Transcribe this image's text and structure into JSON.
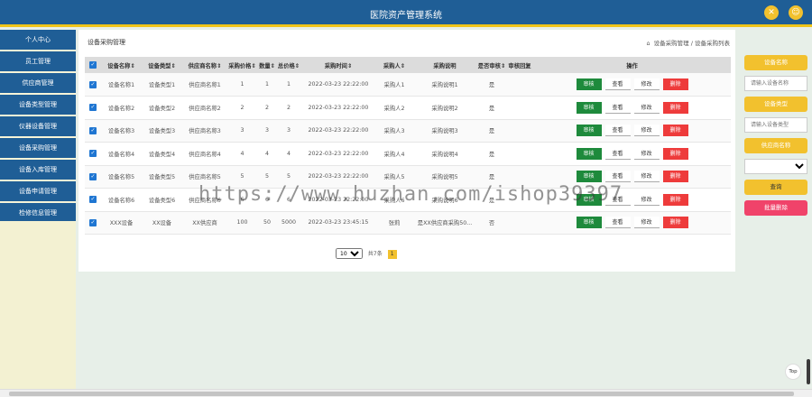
{
  "header": {
    "title": "医院资产管理系统"
  },
  "sidebar": {
    "items": [
      {
        "label": "个人中心"
      },
      {
        "label": "员工管理"
      },
      {
        "label": "供应商管理"
      },
      {
        "label": "设备类型管理"
      },
      {
        "label": "仪器设备管理"
      },
      {
        "label": "设备采购管理"
      },
      {
        "label": "设备入库管理"
      },
      {
        "label": "设备申请管理"
      },
      {
        "label": "检修信息管理"
      }
    ]
  },
  "page": {
    "title": "设备采购管理",
    "breadcrumb": "设备采购管理 / 设备采购列表"
  },
  "table": {
    "headers": [
      "设备名称⇕",
      "设备类型⇕",
      "供应商名称⇕",
      "采购价格⇕",
      "数量⇕",
      "总价格⇕",
      "采购时间⇕",
      "采购人⇕",
      "采购说明",
      "是否审核⇕",
      "审核回复",
      "操作"
    ],
    "rows": [
      [
        "设备名称1",
        "设备类型1",
        "供应商名称1",
        "1",
        "1",
        "1",
        "2022-03-23 22:22:00",
        "采购人1",
        "采购说明1",
        "是",
        ""
      ],
      [
        "设备名称2",
        "设备类型2",
        "供应商名称2",
        "2",
        "2",
        "2",
        "2022-03-23 22:22:00",
        "采购人2",
        "采购说明2",
        "是",
        ""
      ],
      [
        "设备名称3",
        "设备类型3",
        "供应商名称3",
        "3",
        "3",
        "3",
        "2022-03-23 22:22:00",
        "采购人3",
        "采购说明3",
        "是",
        ""
      ],
      [
        "设备名称4",
        "设备类型4",
        "供应商名称4",
        "4",
        "4",
        "4",
        "2022-03-23 22:22:00",
        "采购人4",
        "采购说明4",
        "是",
        ""
      ],
      [
        "设备名称5",
        "设备类型5",
        "供应商名称5",
        "5",
        "5",
        "5",
        "2022-03-23 22:22:00",
        "采购人5",
        "采购说明5",
        "是",
        ""
      ],
      [
        "设备名称6",
        "设备类型6",
        "供应商名称6",
        "6",
        "6",
        "6",
        "2022-03-23 22:22:00",
        "采购人6",
        "采购说明6",
        "是",
        ""
      ],
      [
        "XXX设备",
        "XX设备",
        "XX供应商",
        "100",
        "50",
        "5000",
        "2022-03-23 23:45:15",
        "张莉",
        "是XX供应商采购50...",
        "否",
        ""
      ]
    ],
    "actions": {
      "approve": "审核",
      "view": "查看",
      "edit": "修改",
      "delete": "删除"
    }
  },
  "pagination": {
    "page_size": "10",
    "total_text": "共7条",
    "current": "1"
  },
  "search": {
    "device_name_label": "设备名称",
    "device_name_placeholder": "请输入设备名称",
    "device_type_label": "设备类型",
    "device_type_placeholder": "请输入设备类型",
    "supplier_label": "供应商名称",
    "query_label": "查询",
    "bulk_delete_label": "批量删除"
  },
  "watermark": "https://www.huzhan.com/ishop39397",
  "misc": {
    "top_label": "Top"
  },
  "icons": {
    "close": "close-icon",
    "user": "user-icon",
    "home": "home-icon",
    "check": "checkbox-icon"
  },
  "colors": {
    "brand": "#1f5e96",
    "accent": "#f2c12e",
    "approve": "#1e8a3c",
    "delete": "#ee3b3b"
  }
}
